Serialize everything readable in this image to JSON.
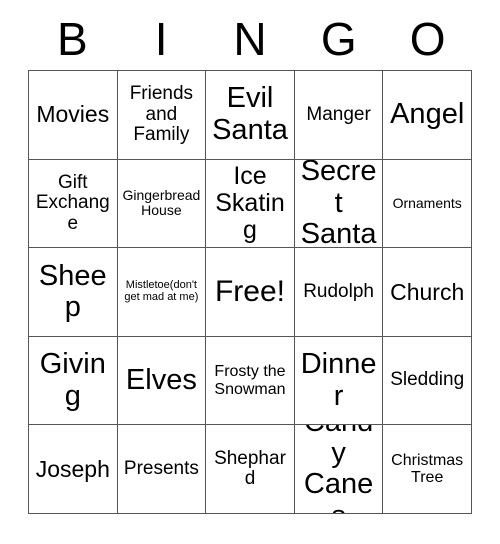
{
  "card": {
    "title": "BINGO",
    "header_letters": [
      "B",
      "I",
      "N",
      "G",
      "O"
    ],
    "columns": 5,
    "rows": 5,
    "colors": {
      "background": "#ffffff",
      "text": "#000000",
      "grid_line": "#555555"
    },
    "cells": [
      {
        "text": "Movies",
        "size": "lg",
        "free": false,
        "row": 1,
        "col": 1
      },
      {
        "text": "Friends\nand\nFamily",
        "size": "md",
        "free": false,
        "row": 1,
        "col": 2
      },
      {
        "text": "Evil\nSanta",
        "size": "xxl",
        "free": false,
        "row": 1,
        "col": 3
      },
      {
        "text": "Manger",
        "size": "md",
        "free": false,
        "row": 1,
        "col": 4
      },
      {
        "text": "Angel",
        "size": "xxl",
        "free": false,
        "row": 1,
        "col": 5
      },
      {
        "text": "Gift\nExchange",
        "size": "md",
        "free": false,
        "row": 2,
        "col": 1
      },
      {
        "text": "Gingerbread\nHouse",
        "size": "xs",
        "free": false,
        "row": 2,
        "col": 2
      },
      {
        "text": "Ice\nSkating",
        "size": "xl",
        "free": false,
        "row": 2,
        "col": 3
      },
      {
        "text": "Secret\nSanta",
        "size": "xxl",
        "free": false,
        "row": 2,
        "col": 4
      },
      {
        "text": "Ornaments",
        "size": "xs",
        "free": false,
        "row": 2,
        "col": 5
      },
      {
        "text": "Sheep",
        "size": "xxl",
        "free": false,
        "row": 3,
        "col": 1
      },
      {
        "text": "Mistletoe(don't\nget mad at me)",
        "size": "xxs",
        "free": false,
        "row": 3,
        "col": 2
      },
      {
        "text": "Free!",
        "size": "free",
        "free": true,
        "row": 3,
        "col": 3
      },
      {
        "text": "Rudolph",
        "size": "md",
        "free": false,
        "row": 3,
        "col": 4
      },
      {
        "text": "Church",
        "size": "lg",
        "free": false,
        "row": 3,
        "col": 5
      },
      {
        "text": "Giving",
        "size": "xxl",
        "free": false,
        "row": 4,
        "col": 1
      },
      {
        "text": "Elves",
        "size": "xxl",
        "free": false,
        "row": 4,
        "col": 2
      },
      {
        "text": "Frosty the\nSnowman",
        "size": "sm",
        "free": false,
        "row": 4,
        "col": 3
      },
      {
        "text": "Dinner",
        "size": "xxl",
        "free": false,
        "row": 4,
        "col": 4
      },
      {
        "text": "Sledding",
        "size": "md",
        "free": false,
        "row": 4,
        "col": 5
      },
      {
        "text": "Joseph",
        "size": "lg",
        "free": false,
        "row": 5,
        "col": 1
      },
      {
        "text": "Presents",
        "size": "md",
        "free": false,
        "row": 5,
        "col": 2
      },
      {
        "text": "Shephard",
        "size": "md",
        "free": false,
        "row": 5,
        "col": 3
      },
      {
        "text": "Candy\nCanes",
        "size": "xxl",
        "free": false,
        "row": 5,
        "col": 4
      },
      {
        "text": "Christmas\nTree",
        "size": "sm",
        "free": false,
        "row": 5,
        "col": 5
      }
    ]
  }
}
